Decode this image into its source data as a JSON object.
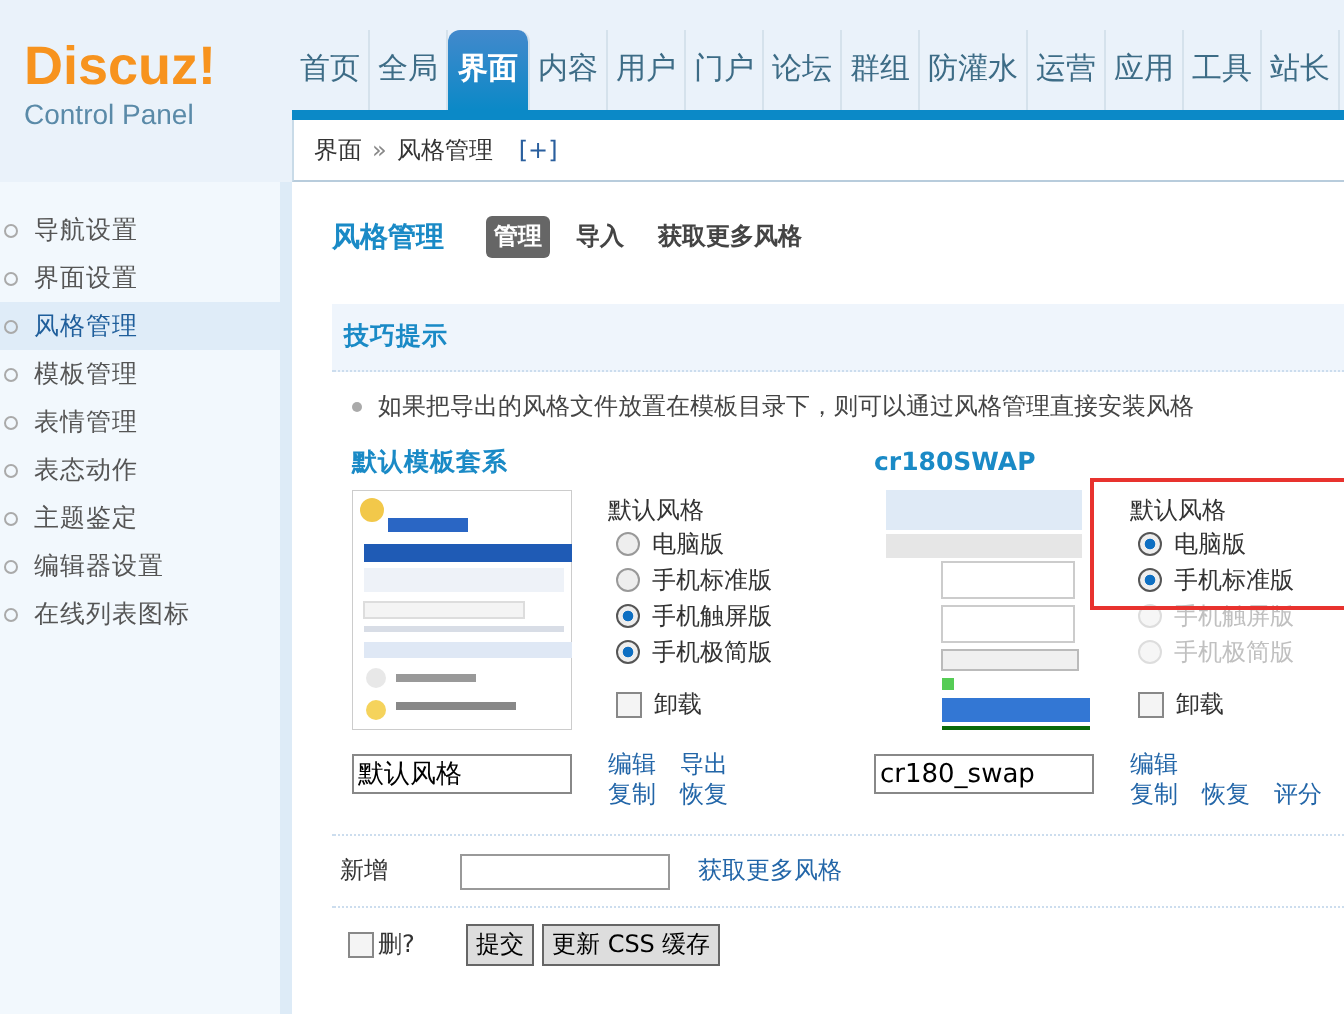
{
  "logo": {
    "brand": "Discuz!",
    "subtitle": "Control Panel"
  },
  "nav": [
    {
      "label": "首页",
      "selected": false
    },
    {
      "label": "全局",
      "selected": false
    },
    {
      "label": "界面",
      "selected": true
    },
    {
      "label": "内容",
      "selected": false
    },
    {
      "label": "用户",
      "selected": false
    },
    {
      "label": "门户",
      "selected": false
    },
    {
      "label": "论坛",
      "selected": false
    },
    {
      "label": "群组",
      "selected": false
    },
    {
      "label": "防灌水",
      "selected": false
    },
    {
      "label": "运营",
      "selected": false
    },
    {
      "label": "应用",
      "selected": false
    },
    {
      "label": "工具",
      "selected": false
    },
    {
      "label": "站长",
      "selected": false
    }
  ],
  "breadcrumb": {
    "items": [
      "界面",
      "风格管理"
    ],
    "separator": "»",
    "add": "[+]"
  },
  "sidebar": {
    "items": [
      {
        "label": "导航设置",
        "selected": false
      },
      {
        "label": "界面设置",
        "selected": false
      },
      {
        "label": "风格管理",
        "selected": true
      },
      {
        "label": "模板管理",
        "selected": false
      },
      {
        "label": "表情管理",
        "selected": false
      },
      {
        "label": "表态动作",
        "selected": false
      },
      {
        "label": "主题鉴定",
        "selected": false
      },
      {
        "label": "编辑器设置",
        "selected": false
      },
      {
        "label": "在线列表图标",
        "selected": false
      }
    ]
  },
  "page": {
    "title": "风格管理",
    "tabs": [
      {
        "label": "管理",
        "selected": true
      },
      {
        "label": "导入",
        "selected": false
      },
      {
        "label": "获取更多风格",
        "selected": false
      }
    ]
  },
  "tips": {
    "title": "技巧提示",
    "items": [
      "如果把导出的风格文件放置在模板目录下，则可以通过风格管理直接安装风格"
    ]
  },
  "styles": [
    {
      "title": "默认模板套系",
      "thumbnail": {
        "kind": "picture"
      },
      "default_label": "默认风格",
      "highlight": false,
      "options": [
        {
          "label": "电脑版",
          "selected": false,
          "disabled": false
        },
        {
          "label": "手机标准版",
          "selected": false,
          "disabled": false
        },
        {
          "label": "手机触屏版",
          "selected": true,
          "disabled": false
        },
        {
          "label": "手机极简版",
          "selected": true,
          "disabled": false
        }
      ],
      "uninstall": {
        "label": "卸载",
        "checked": false
      },
      "name": "默认风格",
      "links": [
        [
          "编辑",
          "导出"
        ],
        [
          "复制",
          "恢复"
        ]
      ]
    },
    {
      "title": "cr180SWAP",
      "thumbnail": {
        "kind": "picture"
      },
      "default_label": "默认风格",
      "highlight": true,
      "options": [
        {
          "label": "电脑版",
          "selected": true,
          "disabled": false
        },
        {
          "label": "手机标准版",
          "selected": true,
          "disabled": false
        },
        {
          "label": "手机触屏版",
          "selected": false,
          "disabled": true
        },
        {
          "label": "手机极简版",
          "selected": false,
          "disabled": true
        }
      ],
      "uninstall": {
        "label": "卸载",
        "checked": false
      },
      "name": "cr180_swap",
      "links": [
        [
          "编辑"
        ],
        [
          "复制",
          "恢复",
          "评分"
        ]
      ]
    }
  ],
  "add_row": {
    "label": "新增",
    "link": "获取更多风格"
  },
  "footer": {
    "delete": {
      "label": "删?",
      "checked": false
    },
    "buttons": [
      "提交",
      "更新 CSS 缓存"
    ]
  }
}
